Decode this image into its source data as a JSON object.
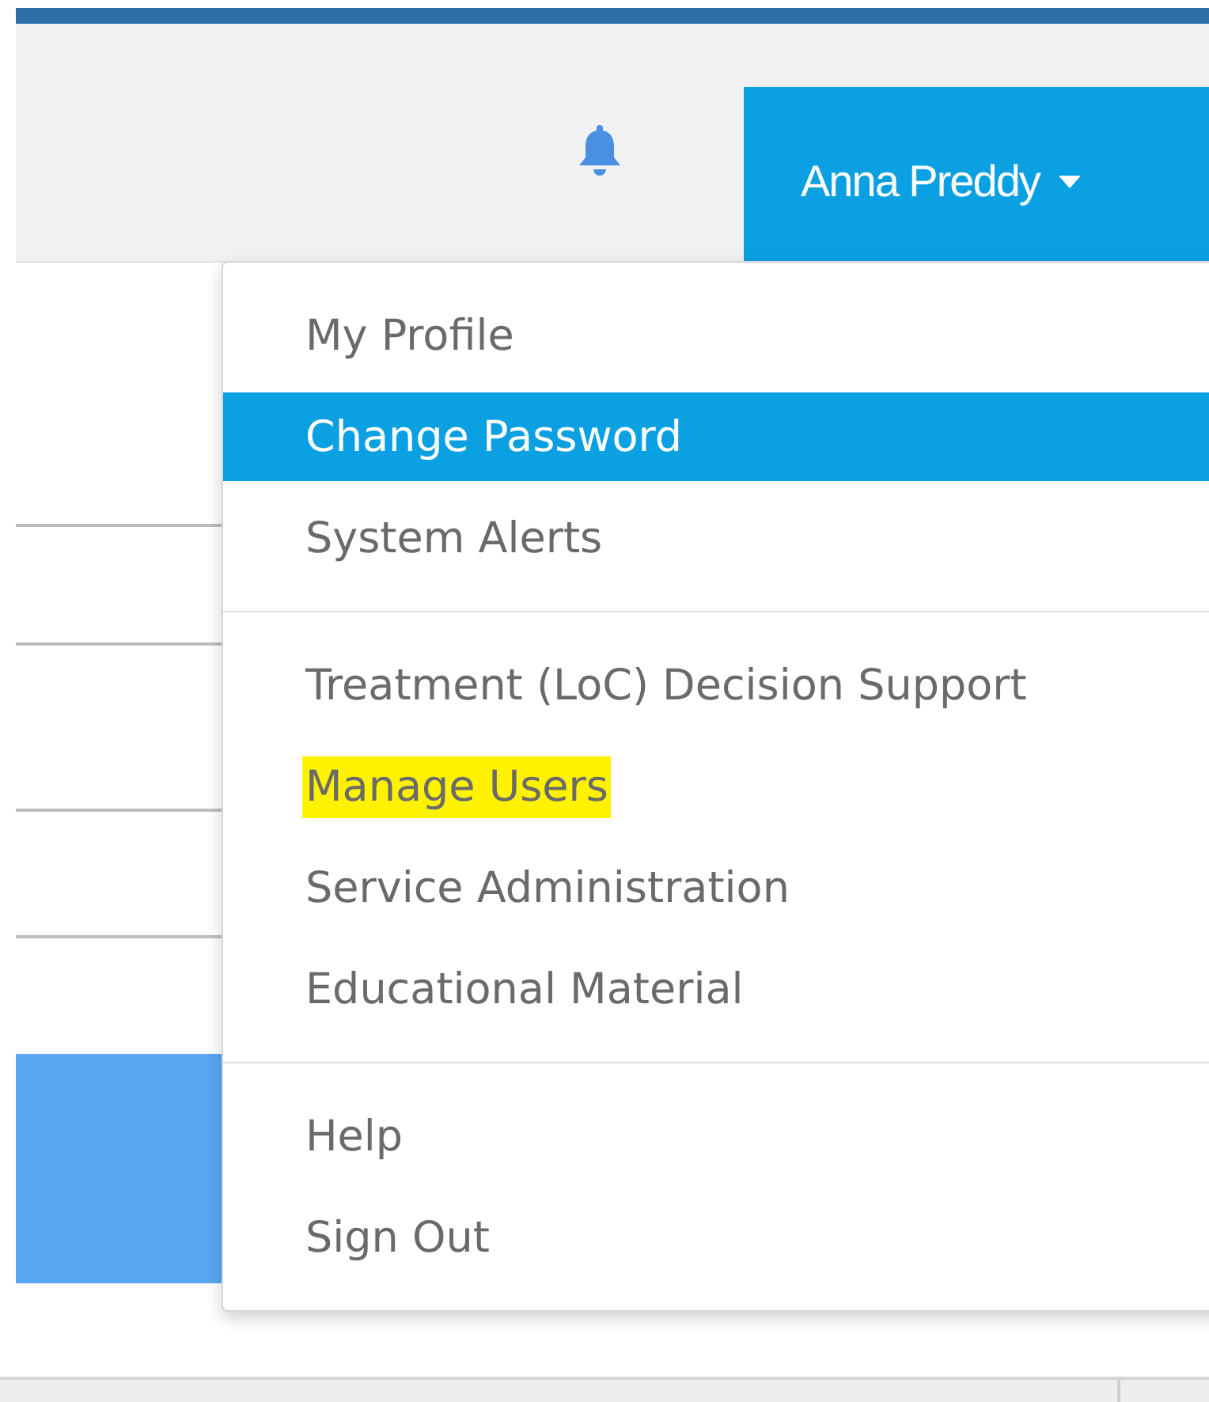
{
  "header": {
    "user_name": "Anna Preddy"
  },
  "menu": {
    "sections": [
      {
        "items": [
          {
            "label": "My Profile",
            "selected": false,
            "highlighted": false
          },
          {
            "label": "Change Password",
            "selected": true,
            "highlighted": false
          },
          {
            "label": "System Alerts",
            "selected": false,
            "highlighted": false
          }
        ]
      },
      {
        "items": [
          {
            "label": "Treatment (LoC) Decision Support",
            "selected": false,
            "highlighted": false
          },
          {
            "label": "Manage Users",
            "selected": false,
            "highlighted": true
          },
          {
            "label": "Service Administration",
            "selected": false,
            "highlighted": false
          },
          {
            "label": "Educational Material",
            "selected": false,
            "highlighted": false
          }
        ]
      },
      {
        "items": [
          {
            "label": "Help",
            "selected": false,
            "highlighted": false
          },
          {
            "label": "Sign Out",
            "selected": false,
            "highlighted": false
          }
        ]
      }
    ]
  }
}
